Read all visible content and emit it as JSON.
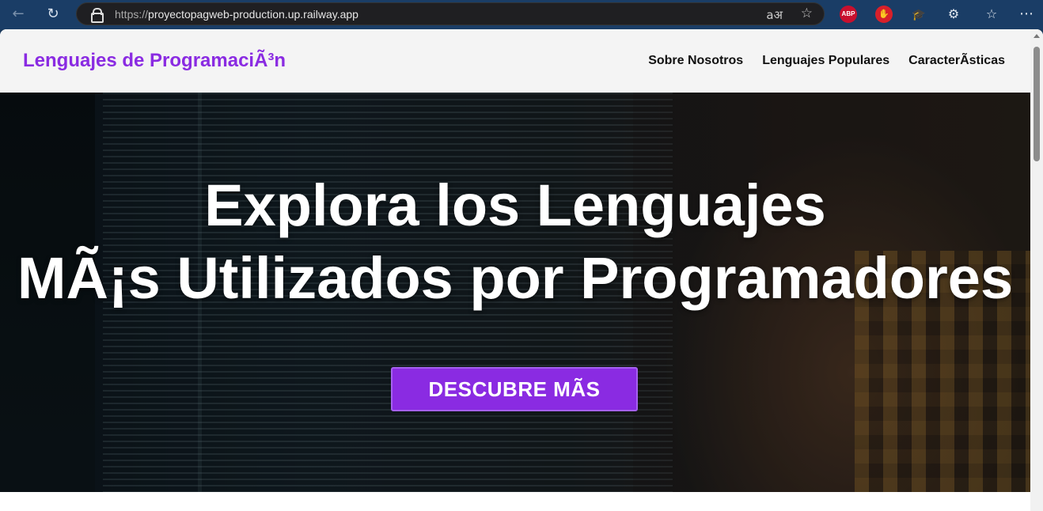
{
  "browser": {
    "url_protocol": "https://",
    "url_host": "proyectopagweb-production.up.railway.app",
    "extensions": {
      "abp": "ABP"
    },
    "icons": [
      "back-arrow-icon",
      "reload-icon",
      "lock-icon",
      "read-aloud-icon",
      "star-icon",
      "adblock-plus-icon",
      "hand-stop-icon",
      "graduation-cap-icon",
      "puzzle-icon",
      "favorites-icon",
      "more-icon"
    ]
  },
  "site": {
    "logo": "Lenguajes de ProgramaciÃ³n",
    "nav": [
      "Sobre Nosotros",
      "Lenguajes Populares",
      "CaracterÃsticas"
    ],
    "hero": {
      "title_line1": "Explora los Lenguajes",
      "title_line2": "MÃ¡s Utilizados por Programadores",
      "cta": "DESCUBRE MÃS"
    }
  },
  "colors": {
    "accent": "#8a2be2",
    "header_bg": "#f4f4f4",
    "browser_bar": "#1a3d66"
  }
}
